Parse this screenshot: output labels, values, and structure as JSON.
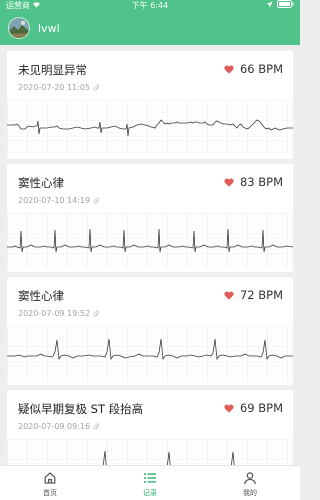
{
  "status_bar": {
    "carrier": "运营商",
    "time": "下午 6:44"
  },
  "profile": {
    "username": "lvwl",
    "avatar_icon": "landscape-avatar-icon"
  },
  "records": [
    {
      "title": "未见明显异常",
      "bpm": "66 BPM",
      "datetime": "2020-07-20 11:05",
      "heart_icon": "heart-icon",
      "attachment_icon": "paperclip-icon"
    },
    {
      "title": "窦性心律",
      "bpm": "83 BPM",
      "datetime": "2020-07-10 14:19",
      "heart_icon": "heart-icon",
      "attachment_icon": "paperclip-icon"
    },
    {
      "title": "窦性心律",
      "bpm": "72 BPM",
      "datetime": "2020-07-09 19:52",
      "heart_icon": "heart-icon",
      "attachment_icon": "paperclip-icon"
    },
    {
      "title": "疑似早期复极 ST 段抬高",
      "bpm": "69 BPM",
      "datetime": "2020-07-09 09:16",
      "heart_icon": "heart-icon",
      "attachment_icon": "paperclip-icon"
    }
  ],
  "tabbar": {
    "tabs": [
      {
        "label": "首页",
        "icon": "home-icon",
        "active": false
      },
      {
        "label": "记录",
        "icon": "list-icon",
        "active": true
      },
      {
        "label": "我的",
        "icon": "person-icon",
        "active": false
      }
    ]
  },
  "colors": {
    "header": "#4fc38a",
    "heart": "#e05a5a",
    "active_tab": "#2fb36e",
    "background": "#eeeeee"
  }
}
